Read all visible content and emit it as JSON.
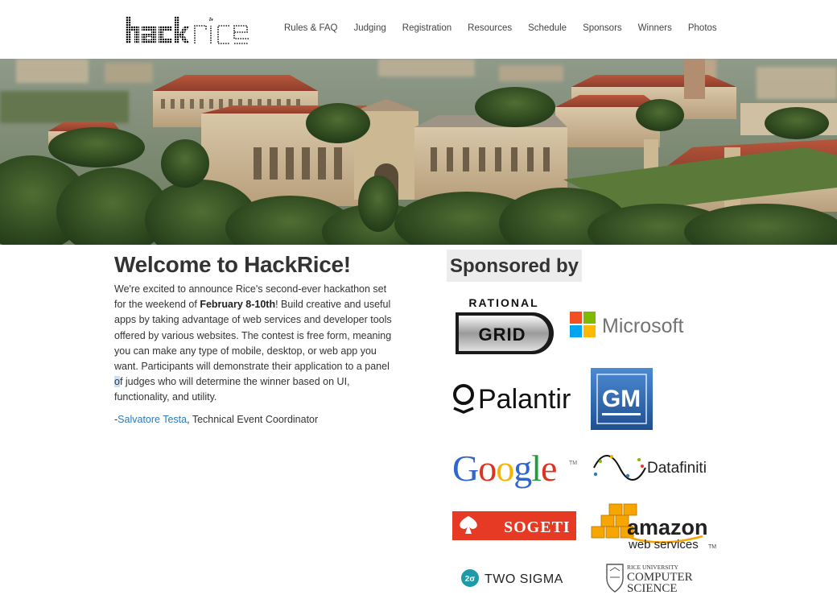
{
  "header": {
    "logo_text": "hackrice",
    "nav": [
      {
        "label": "Rules & FAQ"
      },
      {
        "label": "Judging"
      },
      {
        "label": "Registration"
      },
      {
        "label": "Resources"
      },
      {
        "label": "Schedule"
      },
      {
        "label": "Sponsors"
      },
      {
        "label": "Winners"
      },
      {
        "label": "Photos"
      }
    ]
  },
  "intro": {
    "title": "Welcome to HackRice!",
    "p1_a": "We're excited to announce Rice's second-ever hackathon set for the weekend of ",
    "p1_bold": "February 8-10th",
    "p1_b": "! Build creative and useful apps by taking advantage of web services and developer tools offered by various websites. The contest is free form, meaning you can make any type of mobile, desktop, or web app you want. Participants will demonstrate their application to a panel ",
    "p1_hl": "o",
    "p1_c": "f judges who will determine the winner based on UI, functionality, and utility.",
    "sig_prefix": "-",
    "sig_name": "Salvatore Testa",
    "sig_role": ", Technical Event Coordinator"
  },
  "sponsors": {
    "heading": "Sponsored by",
    "items": {
      "rational_top": "RATIONAL",
      "rational_grid": "GRID",
      "microsoft": "Microsoft",
      "palantir": "Palantir",
      "gm": "GM",
      "google": "Google",
      "google_tm": "TM",
      "datafiniti": "Datafiniti",
      "sogeti": "SOGETI",
      "amazon_1": "amazon",
      "amazon_2": "web services",
      "amazon_tm": "TM",
      "twosigma": "TWO SIGMA",
      "twosigma_mark": "2σ",
      "rice_1": "RICE UNIVERSITY",
      "rice_2": "COMPUTER",
      "rice_3": "SCIENCE"
    }
  },
  "colors": {
    "link": "#2a7bbf",
    "text": "#333333",
    "ms_red": "#f25022",
    "ms_green": "#7fba00",
    "ms_blue": "#00a4ef",
    "ms_yellow": "#ffb900",
    "gm_blue": "#2a64a8",
    "sogeti_red": "#e63a25",
    "amazon_orange": "#f7a600"
  }
}
